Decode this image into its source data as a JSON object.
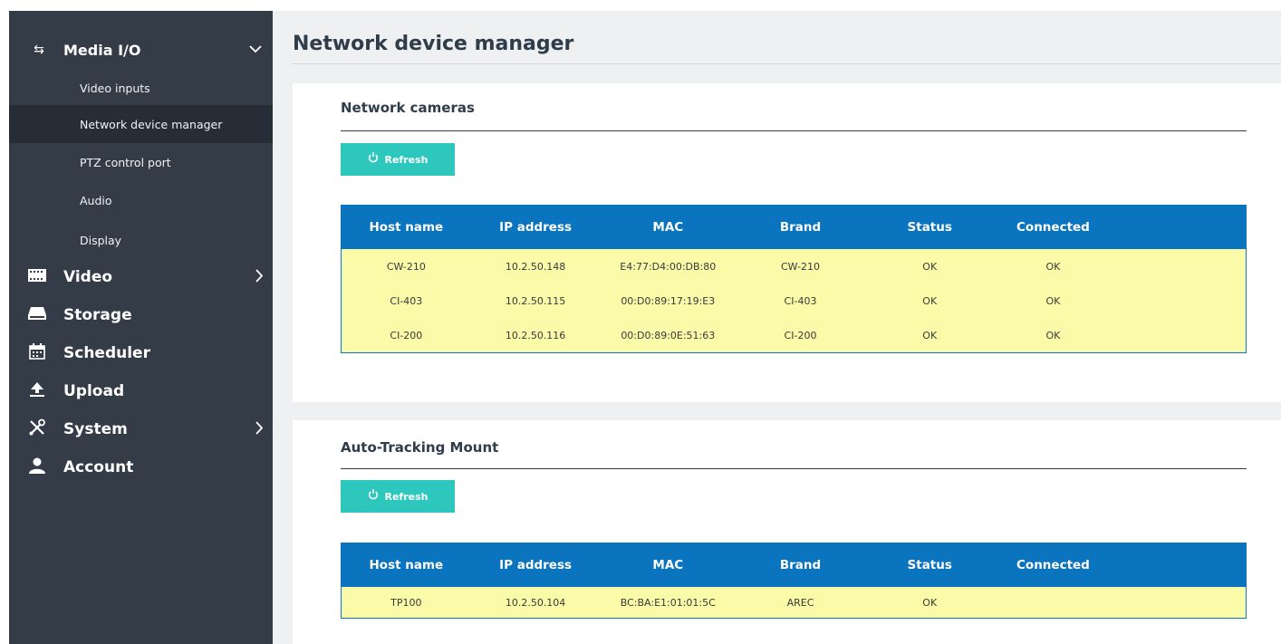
{
  "sidebar": {
    "media_io": {
      "label": "Media I/O",
      "expanded": true
    },
    "media_io_items": [
      {
        "label": "Video inputs",
        "active": false
      },
      {
        "label": "Network device manager",
        "active": true
      },
      {
        "label": "PTZ control port",
        "active": false
      },
      {
        "label": "Audio",
        "active": false
      },
      {
        "label": "Display",
        "active": false
      }
    ],
    "items": [
      {
        "label": "Video",
        "icon": "film-icon",
        "has_chevron": true
      },
      {
        "label": "Storage",
        "icon": "storage-icon",
        "has_chevron": false
      },
      {
        "label": "Scheduler",
        "icon": "calendar-icon",
        "has_chevron": false
      },
      {
        "label": "Upload",
        "icon": "upload-icon",
        "has_chevron": false
      },
      {
        "label": "System",
        "icon": "tools-icon",
        "has_chevron": true
      },
      {
        "label": "Account",
        "icon": "user-icon",
        "has_chevron": false
      }
    ]
  },
  "page_title": "Network device manager",
  "network_cameras": {
    "title": "Network cameras",
    "refresh_label": "Refresh",
    "columns": [
      "Host name",
      "IP address",
      "MAC",
      "Brand",
      "Status",
      "Connected"
    ],
    "rows": [
      [
        "CW-210",
        "10.2.50.148",
        "E4:77:D4:00:DB:80",
        "CW-210",
        "OK",
        "OK"
      ],
      [
        "CI-403",
        "10.2.50.115",
        "00:D0:89:17:19:E3",
        "CI-403",
        "OK",
        "OK"
      ],
      [
        "CI-200",
        "10.2.50.116",
        "00:D0:89:0E:51:63",
        "CI-200",
        "OK",
        "OK"
      ]
    ]
  },
  "auto_tracking": {
    "title": "Auto-Tracking Mount",
    "refresh_label": "Refresh",
    "columns": [
      "Host name",
      "IP address",
      "MAC",
      "Brand",
      "Status",
      "Connected"
    ],
    "rows": [
      [
        "TP100",
        "10.2.50.104",
        "BC:BA:E1:01:01:5C",
        "AREC",
        "OK",
        ""
      ]
    ]
  },
  "colors": {
    "sidebar_bg": "#333c47",
    "sidebar_active": "#262d36",
    "accent_teal": "#2ec7bd",
    "table_header": "#0a74bf",
    "row_bg": "#fafaa8"
  }
}
